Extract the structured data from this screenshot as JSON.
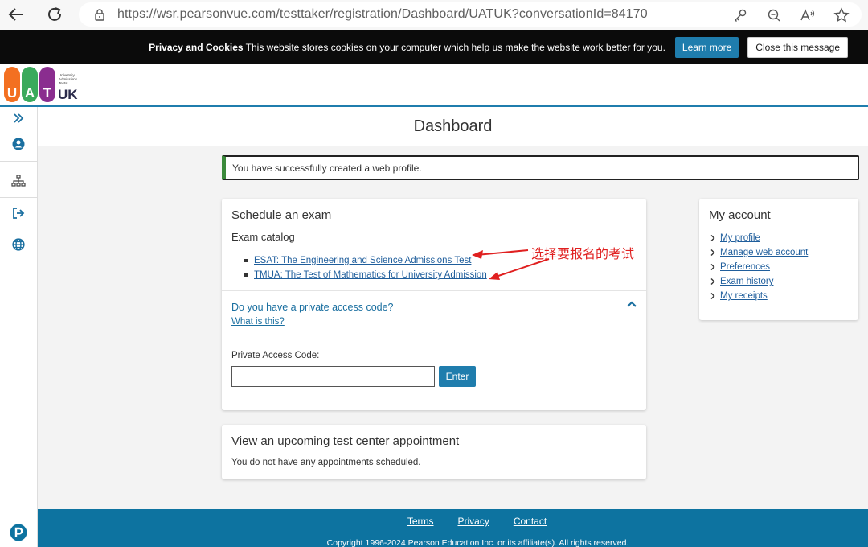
{
  "browser": {
    "url": "https://wsr.pearsonvue.com/testtaker/registration/Dashboard/UATUK?conversationId=84170"
  },
  "cookie_banner": {
    "heading": "Privacy and Cookies",
    "text": " This website stores cookies on your computer which help us make the website work better for you.",
    "learn_more": "Learn more",
    "close_message": "Close this message"
  },
  "logo": {
    "letters": [
      "U",
      "A",
      "T"
    ],
    "letter_colors": [
      "#f37021",
      "#3aaa5c",
      "#8a2d8f"
    ],
    "small_text": "University Admissions Tests",
    "uk": "UK"
  },
  "page": {
    "title": "Dashboard"
  },
  "alert": {
    "message": "You have successfully created a web profile."
  },
  "schedule": {
    "title": "Schedule an exam",
    "catalog_label": "Exam catalog",
    "exams": [
      "ESAT: The Engineering and Science Admissions Test",
      "TMUA: The Test of Mathematics for University Admission"
    ],
    "access_question": "Do you have a private access code?",
    "what_is_this": "What is this?",
    "pac_label": "Private Access Code:",
    "pac_value": "",
    "enter": "Enter"
  },
  "appointments": {
    "title": "View an upcoming test center appointment",
    "message": "You do not have any appointments scheduled."
  },
  "account": {
    "title": "My account",
    "links": [
      "My profile",
      "Manage web account",
      "Preferences",
      "Exam history",
      "My receipts"
    ]
  },
  "annotation": {
    "text": "选择要报名的考试",
    "color": "#e02020"
  },
  "footer": {
    "links": [
      "Terms",
      "Privacy",
      "Contact"
    ],
    "copyright": "Copyright 1996-2024 Pearson Education Inc. or its affiliate(s). All rights reserved."
  },
  "colors": {
    "accent": "#1f7dad",
    "success_border": "#3b8a3b",
    "footer": "#0d73a0"
  }
}
